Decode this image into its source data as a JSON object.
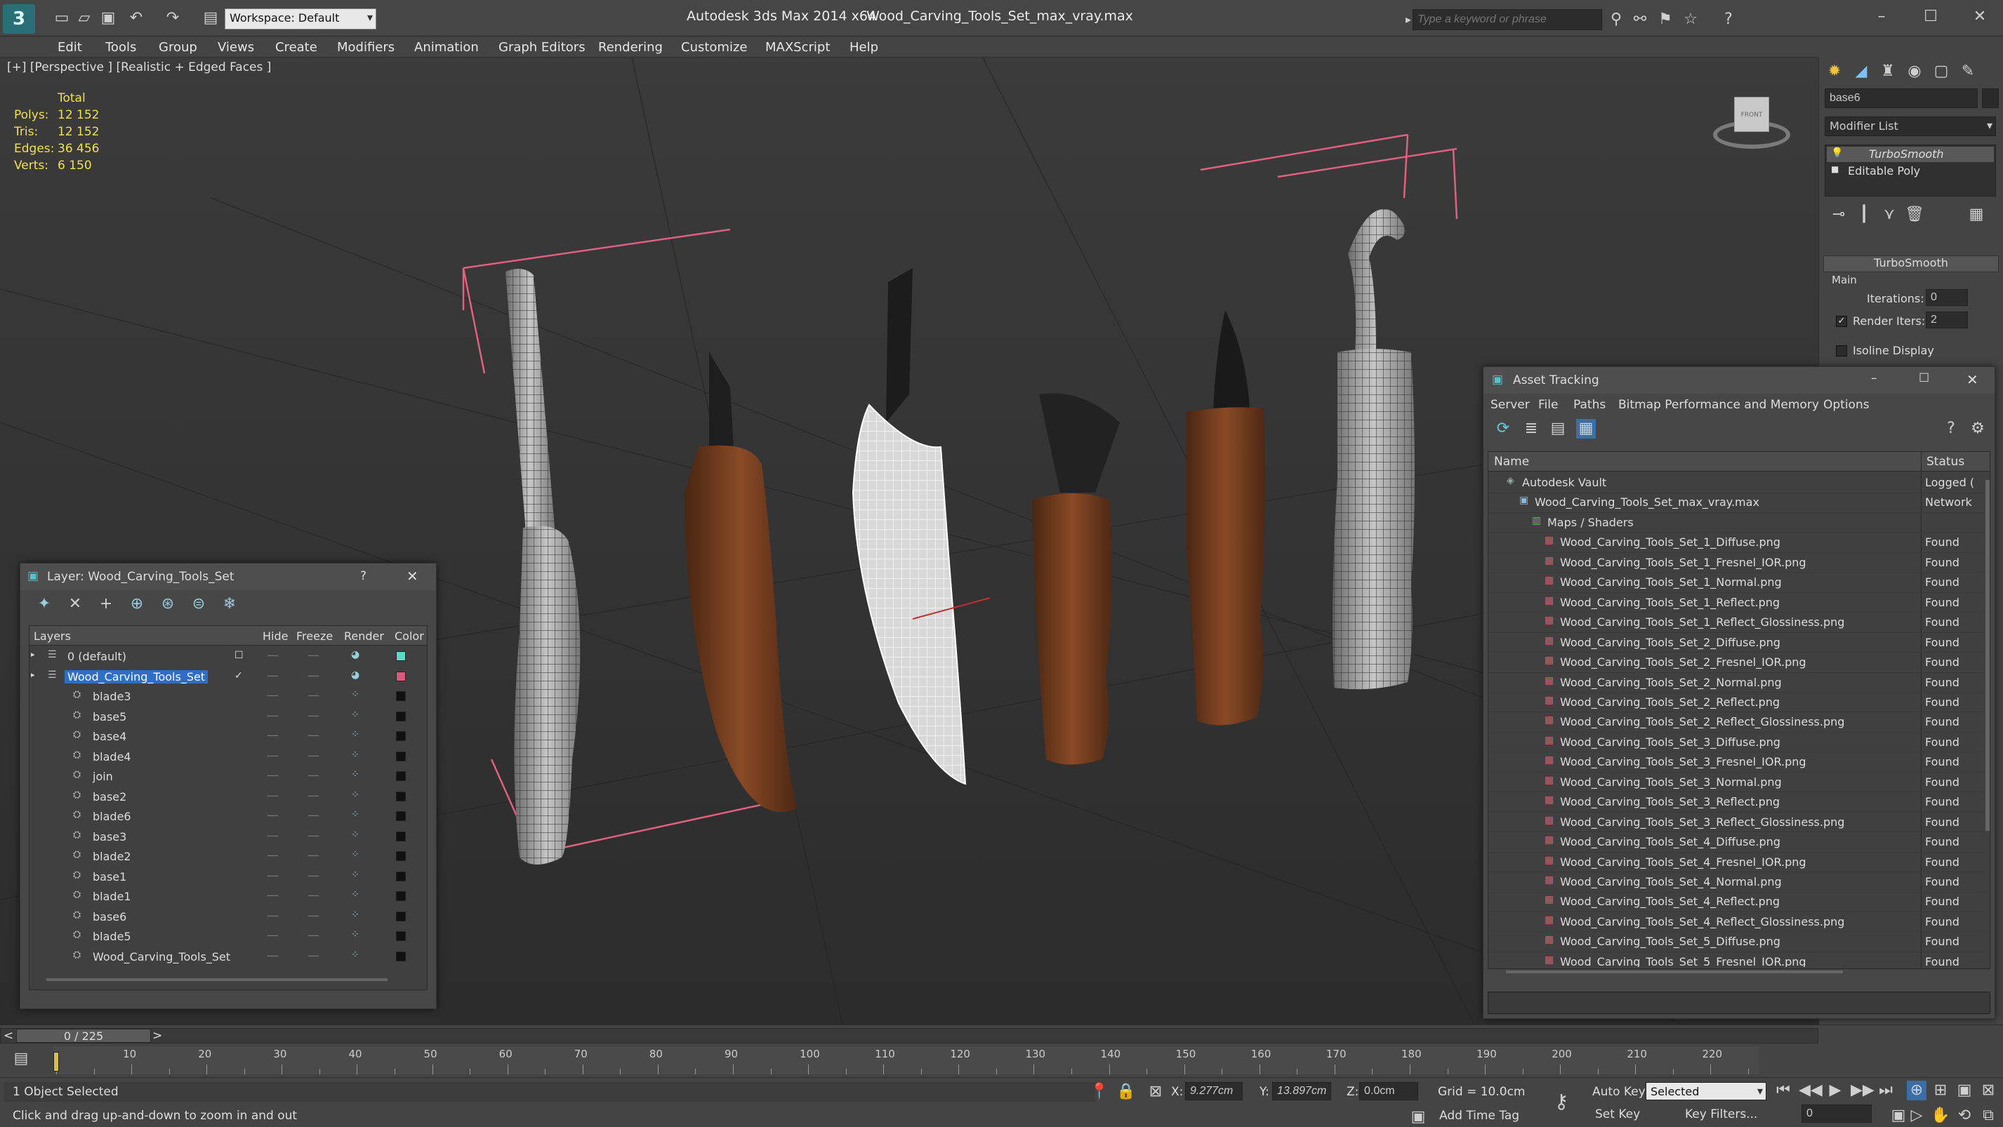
{
  "titlebar": {
    "workspace_label": "Workspace: Default",
    "app_title": "Autodesk 3ds Max  2014 x64",
    "file_title": "Wood_Carving_Tools_Set_max_vray.max",
    "search_placeholder": "Type a keyword or phrase"
  },
  "menu": [
    "Edit",
    "Tools",
    "Group",
    "Views",
    "Create",
    "Modifiers",
    "Animation",
    "Graph Editors",
    "Rendering",
    "Customize",
    "MAXScript",
    "Help"
  ],
  "viewport": {
    "label": "[+] [Perspective ] [Realistic + Edged Faces ]",
    "stats": {
      "total_label": "Total",
      "rows": [
        {
          "label": "Polys:",
          "value": "12 152"
        },
        {
          "label": "Tris:",
          "value": "12 152"
        },
        {
          "label": "Edges:",
          "value": "36 456"
        },
        {
          "label": "Verts:",
          "value": "6 150"
        }
      ]
    },
    "viewcube_label": "FRONT"
  },
  "command_panel": {
    "object_name": "base6",
    "modifier_list_label": "Modifier List",
    "stack": [
      "TurboSmooth",
      "Editable Poly"
    ],
    "rollout_title": "TurboSmooth",
    "main_group": "Main",
    "iterations_label": "Iterations:",
    "iterations_value": "0",
    "render_iters_label": "Render Iters:",
    "render_iters_value": "2",
    "isoline_label": "Isoline Display"
  },
  "layer_window": {
    "title": "Layer: Wood_Carving_Tools_Set",
    "help": "?",
    "columns": [
      "Layers",
      "Hide",
      "Freeze",
      "Render",
      "Color"
    ],
    "rows": [
      {
        "name": "0 (default)",
        "level": 0,
        "color": "#5fd7c8",
        "selected": false
      },
      {
        "name": "Wood_Carving_Tools_Set",
        "level": 0,
        "color": "#d85b7d",
        "selected": true
      },
      {
        "name": "blade3",
        "level": 1,
        "color": "#111111",
        "selected": false
      },
      {
        "name": "base5",
        "level": 1,
        "color": "#111111",
        "selected": false
      },
      {
        "name": "base4",
        "level": 1,
        "color": "#111111",
        "selected": false
      },
      {
        "name": "blade4",
        "level": 1,
        "color": "#111111",
        "selected": false
      },
      {
        "name": "join",
        "level": 1,
        "color": "#111111",
        "selected": false
      },
      {
        "name": "base2",
        "level": 1,
        "color": "#111111",
        "selected": false
      },
      {
        "name": "blade6",
        "level": 1,
        "color": "#111111",
        "selected": false
      },
      {
        "name": "base3",
        "level": 1,
        "color": "#111111",
        "selected": false
      },
      {
        "name": "blade2",
        "level": 1,
        "color": "#111111",
        "selected": false
      },
      {
        "name": "base1",
        "level": 1,
        "color": "#111111",
        "selected": false
      },
      {
        "name": "blade1",
        "level": 1,
        "color": "#111111",
        "selected": false
      },
      {
        "name": "base6",
        "level": 1,
        "color": "#111111",
        "selected": false
      },
      {
        "name": "blade5",
        "level": 1,
        "color": "#111111",
        "selected": false
      },
      {
        "name": "Wood_Carving_Tools_Set",
        "level": 1,
        "color": "#111111",
        "selected": false
      }
    ]
  },
  "asset_window": {
    "title": "Asset Tracking",
    "menu": [
      "Server",
      "File",
      "Paths",
      "Bitmap Performance and Memory",
      "Options"
    ],
    "columns": [
      "Name",
      "Status"
    ],
    "rows": [
      {
        "name": "Autodesk Vault",
        "status": "Logged (",
        "level": 0
      },
      {
        "name": "Wood_Carving_Tools_Set_max_vray.max",
        "status": "Network",
        "level": 1
      },
      {
        "name": "Maps / Shaders",
        "status": "",
        "level": 2
      },
      {
        "name": "Wood_Carving_Tools_Set_1_Diffuse.png",
        "status": "Found",
        "level": 3
      },
      {
        "name": "Wood_Carving_Tools_Set_1_Fresnel_IOR.png",
        "status": "Found",
        "level": 3
      },
      {
        "name": "Wood_Carving_Tools_Set_1_Normal.png",
        "status": "Found",
        "level": 3
      },
      {
        "name": "Wood_Carving_Tools_Set_1_Reflect.png",
        "status": "Found",
        "level": 3
      },
      {
        "name": "Wood_Carving_Tools_Set_1_Reflect_Glossiness.png",
        "status": "Found",
        "level": 3
      },
      {
        "name": "Wood_Carving_Tools_Set_2_Diffuse.png",
        "status": "Found",
        "level": 3
      },
      {
        "name": "Wood_Carving_Tools_Set_2_Fresnel_IOR.png",
        "status": "Found",
        "level": 3
      },
      {
        "name": "Wood_Carving_Tools_Set_2_Normal.png",
        "status": "Found",
        "level": 3
      },
      {
        "name": "Wood_Carving_Tools_Set_2_Reflect.png",
        "status": "Found",
        "level": 3
      },
      {
        "name": "Wood_Carving_Tools_Set_2_Reflect_Glossiness.png",
        "status": "Found",
        "level": 3
      },
      {
        "name": "Wood_Carving_Tools_Set_3_Diffuse.png",
        "status": "Found",
        "level": 3
      },
      {
        "name": "Wood_Carving_Tools_Set_3_Fresnel_IOR.png",
        "status": "Found",
        "level": 3
      },
      {
        "name": "Wood_Carving_Tools_Set_3_Normal.png",
        "status": "Found",
        "level": 3
      },
      {
        "name": "Wood_Carving_Tools_Set_3_Reflect.png",
        "status": "Found",
        "level": 3
      },
      {
        "name": "Wood_Carving_Tools_Set_3_Reflect_Glossiness.png",
        "status": "Found",
        "level": 3
      },
      {
        "name": "Wood_Carving_Tools_Set_4_Diffuse.png",
        "status": "Found",
        "level": 3
      },
      {
        "name": "Wood_Carving_Tools_Set_4_Fresnel_IOR.png",
        "status": "Found",
        "level": 3
      },
      {
        "name": "Wood_Carving_Tools_Set_4_Normal.png",
        "status": "Found",
        "level": 3
      },
      {
        "name": "Wood_Carving_Tools_Set_4_Reflect.png",
        "status": "Found",
        "level": 3
      },
      {
        "name": "Wood_Carving_Tools_Set_4_Reflect_Glossiness.png",
        "status": "Found",
        "level": 3
      },
      {
        "name": "Wood_Carving_Tools_Set_5_Diffuse.png",
        "status": "Found",
        "level": 3
      },
      {
        "name": "Wood_Carving_Tools_Set_5_Fresnel_IOR.png",
        "status": "Found",
        "level": 3
      }
    ]
  },
  "timeline": {
    "frame_counter": "0 / 225",
    "ticks": [
      "10",
      "20",
      "30",
      "40",
      "50",
      "60",
      "70",
      "80",
      "90",
      "100",
      "110",
      "120",
      "130",
      "140",
      "150",
      "160",
      "170",
      "180",
      "190",
      "200",
      "210",
      "220"
    ]
  },
  "status": {
    "selection": "1 Object Selected",
    "prompt": "Click and drag up-and-down to zoom in and out",
    "x_label": "X:",
    "x_value": "9.277cm",
    "y_label": "Y:",
    "y_value": "13.897cm",
    "z_label": "Z:",
    "z_value": "0.0cm",
    "grid": "Grid = 10.0cm",
    "add_time_tag": "Add Time Tag",
    "auto_key": "Auto Key",
    "set_key": "Set Key",
    "selected_dropdown": "Selected",
    "key_filters": "Key Filters...",
    "frame_value": "0"
  }
}
